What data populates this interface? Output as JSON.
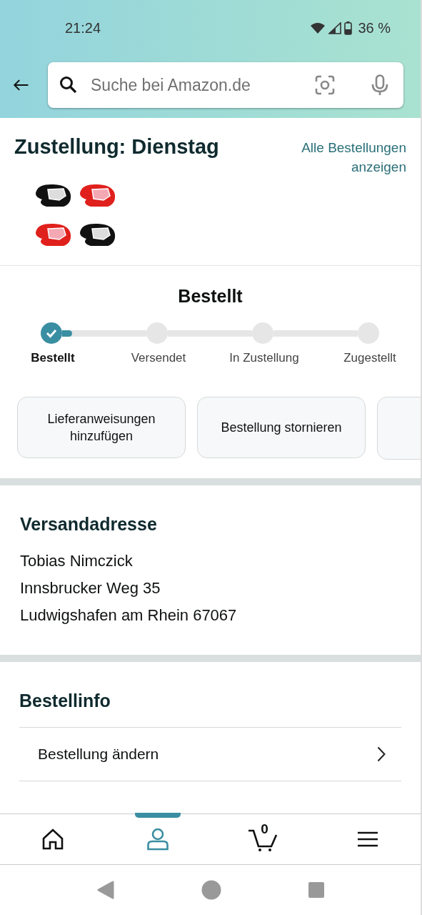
{
  "status_bar": {
    "time": "21:24",
    "battery": "36 %"
  },
  "search": {
    "placeholder": "Suche bei Amazon.de"
  },
  "delivery": {
    "title": "Zustellung: Dienstag",
    "link": "Alle Bestellungen anzeigen"
  },
  "progress": {
    "title": "Bestellt",
    "level": 0.04,
    "steps": [
      {
        "label": "Bestellt",
        "done": true
      },
      {
        "label": "Versendet",
        "done": false
      },
      {
        "label": "In Zustellung",
        "done": false
      },
      {
        "label": "Zugestellt",
        "done": false
      }
    ]
  },
  "actions": [
    "Lieferanweisungen hinzufügen",
    "Bestellung stornieren"
  ],
  "address": {
    "title": "Versandadresse",
    "lines": [
      "Tobias Nimczick",
      "Innsbrucker Weg 35",
      "Ludwigshafen am Rhein 67067"
    ]
  },
  "order_info": {
    "title": "Bestellinfo",
    "items": [
      "Bestellung ändern"
    ]
  },
  "bottom_nav": [
    {
      "kind": "home",
      "selected": false
    },
    {
      "kind": "account",
      "selected": true
    },
    {
      "kind": "cart",
      "selected": false,
      "count": "0"
    },
    {
      "kind": "menu",
      "selected": false
    }
  ]
}
